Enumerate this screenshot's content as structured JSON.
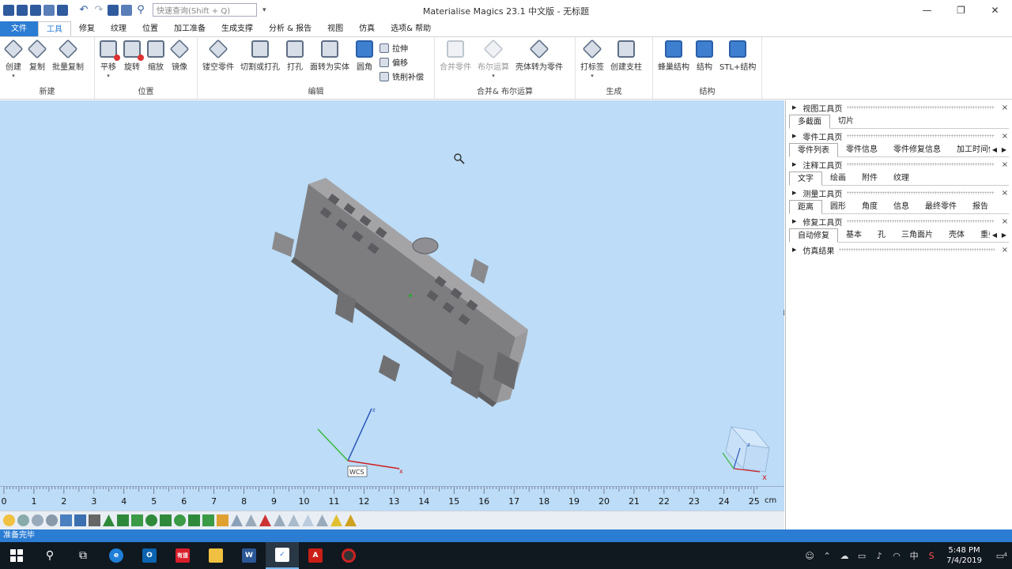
{
  "app": {
    "title": "Materialise Magics 23.1 中文版 - 无标题",
    "search_placeholder": "快速查询(Shift + Q)",
    "qa_dropdown": "▾"
  },
  "window_controls": {
    "minimize": "—",
    "restore": "❐",
    "close": "✕"
  },
  "menu_tabs": {
    "file": "文件",
    "tools": "工具",
    "fix": "修复",
    "texture": "纹理",
    "position": "位置",
    "build_prep": "加工准备",
    "support": "生成支撑",
    "analyze": "分析 & 报告",
    "view": "视图",
    "simulate": "仿真",
    "options": "选项& 帮助"
  },
  "ribbon": {
    "new": {
      "label": "新建",
      "create": "创建",
      "copy": "复制",
      "batch_copy": "批量复制",
      "dd": "▾"
    },
    "position": {
      "label": "位置",
      "translate": "平移",
      "rotate": "旋转",
      "scale": "缩放",
      "mirror": "镜像",
      "dd": "▾"
    },
    "edit": {
      "label": "编辑",
      "hollow": "镂空零件",
      "cut": "切割或打孔",
      "punch": "打孔",
      "face_to_solid": "面转为实体",
      "fillet": "圆角",
      "extrude": "拉伸",
      "offset": "偏移",
      "mill_comp": "铣削补偿"
    },
    "boolean": {
      "label": "合并& 布尔运算",
      "merge": "合并零件",
      "boolean": "布尔运算",
      "shell_to_part": "壳体转为零件",
      "dd": "▾"
    },
    "generate": {
      "label": "生成",
      "label_tool": "打标签",
      "create_support": "创建支柱",
      "dd": "▾"
    },
    "structure": {
      "label": "结构",
      "honeycomb": "蜂巢结构",
      "structure": "结构",
      "stl_structure": "STL+结构"
    }
  },
  "viewport": {
    "wcs_label": "WCS",
    "axis_z": "z",
    "axis_x": "x",
    "cube_x": "x",
    "cube_z": "z"
  },
  "ruler": {
    "unit": "cm",
    "ticks": [
      "0",
      "1",
      "2",
      "3",
      "4",
      "5",
      "6",
      "7",
      "8",
      "9",
      "10",
      "11",
      "12",
      "13",
      "14",
      "15",
      "16",
      "17",
      "18",
      "19",
      "20",
      "21",
      "22",
      "23",
      "24",
      "25"
    ]
  },
  "status": {
    "text": "准备完毕"
  },
  "right_panel": {
    "sections": [
      {
        "title": "视图工具页",
        "tabs": [
          "多截面",
          "切片"
        ],
        "active": 0,
        "arrows": false
      },
      {
        "title": "零件工具页",
        "tabs": [
          "零件列表",
          "零件信息",
          "零件修复信息",
          "加工时间估"
        ],
        "active": 0,
        "arrows": true
      },
      {
        "title": "注释工具页",
        "tabs": [
          "文字",
          "绘画",
          "附件",
          "纹理"
        ],
        "active": 0,
        "arrows": false
      },
      {
        "title": "测量工具页",
        "tabs": [
          "距离",
          "圆形",
          "角度",
          "信息",
          "最终零件",
          "报告"
        ],
        "active": 0,
        "arrows": false
      },
      {
        "title": "修复工具页",
        "tabs": [
          "自动修复",
          "基本",
          "孔",
          "三角面片",
          "壳体",
          "重叠"
        ],
        "active": 0,
        "arrows": true
      },
      {
        "title": "仿真结果",
        "tabs": [],
        "active": -1,
        "arrows": false
      }
    ],
    "close_glyph": "×",
    "tri_glyph": "▶",
    "arrow_left": "◀",
    "arrow_right": "▶"
  },
  "taskbar": {
    "apps": [
      "start",
      "search",
      "task-view",
      "edge",
      "outlook",
      "youdao",
      "explorer",
      "word",
      "magics",
      "acrobat",
      "recorder"
    ],
    "youdao_label": "有道",
    "word_label": "W",
    "outlook_label": "O",
    "ime": "中",
    "time": "5:48 PM",
    "date": "7/4/2019",
    "notify_count": "4"
  },
  "colors": {
    "accent": "#2b7cd3",
    "viewport_bg": "#bcdcf7",
    "part": "#7d7d80"
  }
}
